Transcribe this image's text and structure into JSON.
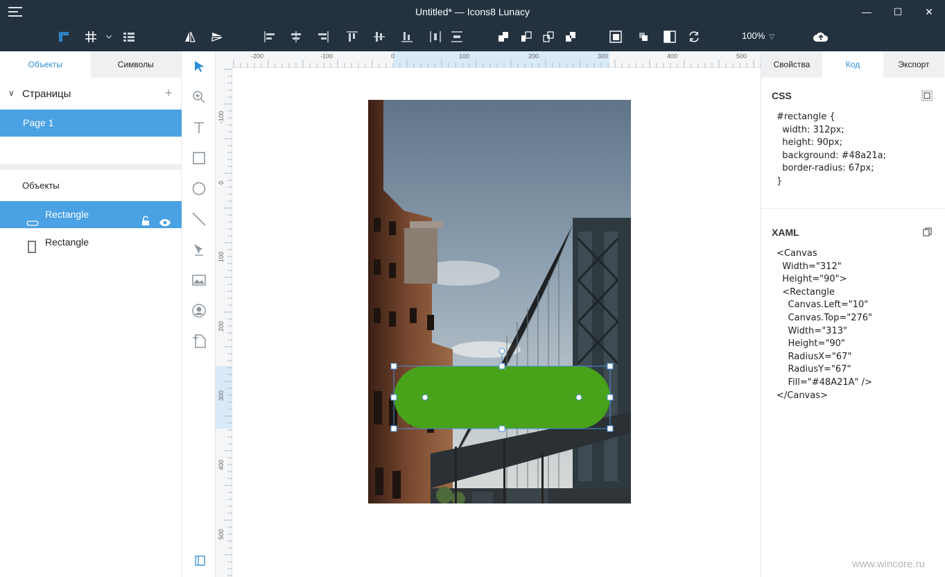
{
  "window": {
    "title": "Untitled* — Icons8 Lunacy",
    "minimize": "—",
    "maximize": "☐",
    "close": "✕"
  },
  "toolbar": {
    "zoom": "100%",
    "icons": [
      "ruler-icon",
      "grid-icon",
      "chevron-down-icon",
      "layout-grid-icon",
      "flip-horizontal-icon",
      "flip-vertical-icon",
      "align-left-icon",
      "align-center-icon",
      "align-right-icon",
      "align-top-icon",
      "align-middle-icon",
      "align-bottom-icon",
      "distribute-horizontal-icon",
      "distribute-vertical-icon",
      "union-icon",
      "subtract-icon",
      "intersect-icon",
      "difference-icon",
      "mask-icon",
      "flatten-icon",
      "invert-icon",
      "rotate-icon",
      "cloud-upload-icon"
    ]
  },
  "left_panel": {
    "tabs": [
      "Объекты",
      "Символы"
    ],
    "pages_header": "Страницы",
    "pages": [
      "Page 1"
    ],
    "objects_header": "Объекты",
    "layers": [
      {
        "name": "Rectangle",
        "selected": true
      },
      {
        "name": "Rectangle",
        "selected": false
      }
    ]
  },
  "ruler": {
    "h_labels": [
      "-200",
      "-100",
      "0",
      "100",
      "200",
      "300",
      "400",
      "500"
    ],
    "v_labels": [
      "-100",
      "0",
      "100",
      "200",
      "300",
      "400",
      "500"
    ]
  },
  "right_panel": {
    "tabs": [
      "Свойства",
      "Код",
      "Экспорт"
    ],
    "css_title": "CSS",
    "css_code": "#rectangle {\n  width: 312px;\n  height: 90px;\n  background: #48a21a;\n  border-radius: 67px;\n}",
    "xaml_title": "XAML",
    "xaml_code": "<Canvas\n  Width=\"312\"\n  Height=\"90\">\n  <Rectangle\n    Canvas.Left=\"10\"\n    Canvas.Top=\"276\"\n    Width=\"313\"\n    Height=\"90\"\n    RadiusX=\"67\"\n    RadiusY=\"67\"\n    Fill=\"#48A21A\" />\n</Canvas>"
  },
  "colors": {
    "accent": "#4aa1e3",
    "titlebar": "#243240",
    "shape_fill": "#48a21a"
  },
  "watermark": "www.wincore.ru"
}
